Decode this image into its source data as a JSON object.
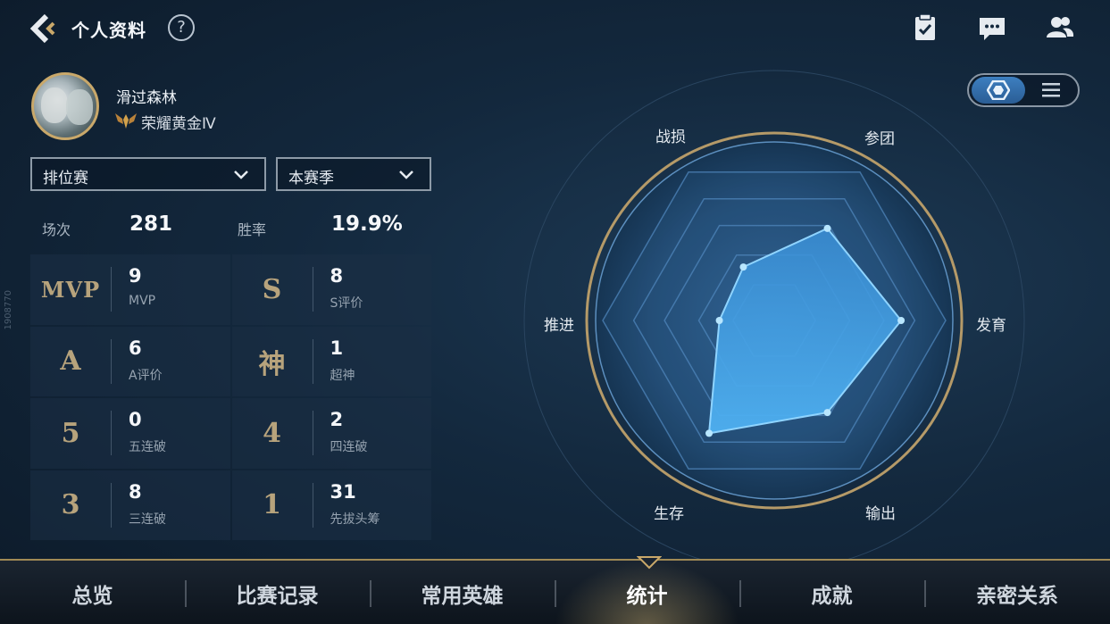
{
  "header": {
    "title": "个人资料",
    "help": "?"
  },
  "profile": {
    "name": "滑过森林",
    "rank": "荣耀黄金Ⅳ"
  },
  "filters": {
    "mode": "排位赛",
    "season": "本赛季"
  },
  "summary": {
    "matches_label": "场次",
    "matches_value": "281",
    "winrate_label": "胜率",
    "winrate_value": "19.9%"
  },
  "stats": [
    {
      "badge": "MVP",
      "value": "9",
      "label": "MVP"
    },
    {
      "badge": "S",
      "value": "8",
      "label": "S评价"
    },
    {
      "badge": "A",
      "value": "6",
      "label": "A评价"
    },
    {
      "badge": "神",
      "value": "1",
      "label": "超神"
    },
    {
      "badge": "5",
      "value": "0",
      "label": "五连破"
    },
    {
      "badge": "4",
      "value": "2",
      "label": "四连破"
    },
    {
      "badge": "3",
      "value": "8",
      "label": "三连破"
    },
    {
      "badge": "1",
      "value": "31",
      "label": "先拔头筹"
    }
  ],
  "side_code": "1908770",
  "radar": {
    "labels": {
      "top_left": "战损",
      "top_right": "参团",
      "right": "发育",
      "bottom_right": "输出",
      "bottom_left": "生存",
      "left": "推进"
    },
    "values": {
      "参团": 0.62,
      "发育": 0.74,
      "输出": 0.62,
      "生存": 0.76,
      "推进": 0.32,
      "战损": 0.36
    }
  },
  "tabs": [
    {
      "label": "总览"
    },
    {
      "label": "比赛记录"
    },
    {
      "label": "常用英雄"
    },
    {
      "label": "统计"
    },
    {
      "label": "成就"
    },
    {
      "label": "亲密关系"
    }
  ],
  "active_tab": "统计",
  "colors": {
    "accent_gold": "#c9a86a",
    "radar_fill": "#3d9be0",
    "radar_stroke": "#8fd4ff"
  }
}
